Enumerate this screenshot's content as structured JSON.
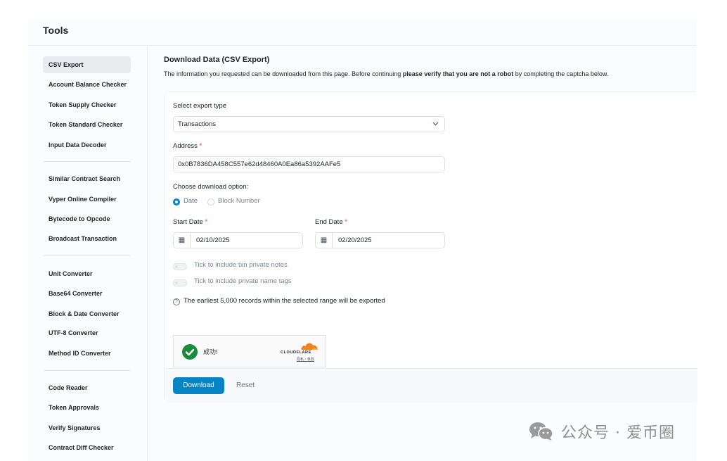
{
  "page": {
    "title": "Tools"
  },
  "sidebar": {
    "groups": [
      {
        "items": [
          {
            "label": "CSV Export",
            "active": true
          },
          {
            "label": "Account Balance Checker"
          },
          {
            "label": "Token Supply Checker"
          },
          {
            "label": "Token Standard Checker"
          },
          {
            "label": "Input Data Decoder"
          }
        ]
      },
      {
        "items": [
          {
            "label": "Similar Contract Search"
          },
          {
            "label": "Vyper Online Compiler"
          },
          {
            "label": "Bytecode to Opcode"
          },
          {
            "label": "Broadcast Transaction"
          }
        ]
      },
      {
        "items": [
          {
            "label": "Unit Converter"
          },
          {
            "label": "Base64 Converter"
          },
          {
            "label": "Block & Date Converter"
          },
          {
            "label": "UTF-8 Converter"
          },
          {
            "label": "Method ID Converter"
          }
        ]
      },
      {
        "items": [
          {
            "label": "Code Reader"
          },
          {
            "label": "Token Approvals"
          },
          {
            "label": "Verify Signatures"
          },
          {
            "label": "Contract Diff Checker"
          }
        ]
      }
    ]
  },
  "main": {
    "title": "Download Data (CSV Export)",
    "subtitle_before": "The information you requested can be downloaded from this page. Before continuing ",
    "subtitle_bold": "please verify that you are not a robot",
    "subtitle_after": " by completing the captcha below.",
    "export_type": {
      "label": "Select export type",
      "value": "Transactions"
    },
    "address": {
      "label": "Address",
      "required_mark": "*",
      "value": "0x0B7836DA458C557e62d48460A0Ea86a5392AAFe5"
    },
    "download_option": {
      "label": "Choose download option:",
      "options": [
        {
          "label": "Date",
          "selected": true
        },
        {
          "label": "Block Number",
          "selected": false
        }
      ]
    },
    "start_date": {
      "label": "Start Date",
      "required_mark": "*",
      "value": "02/10/2025"
    },
    "end_date": {
      "label": "End Date",
      "required_mark": "*",
      "value": "02/20/2025"
    },
    "toggles": [
      {
        "label": "Tick to include txn private notes",
        "checked": false
      },
      {
        "label": "Tick to include private name tags",
        "checked": false
      }
    ],
    "info_text": "The earliest 5,000 records within the selected range will be exported",
    "captcha": {
      "status_text": "成功!",
      "brand": "CLOUDFLARE",
      "links": "隐私・条款"
    },
    "buttons": {
      "download": "Download",
      "reset": "Reset"
    }
  },
  "watermark": {
    "text": "公众号 · 爱币圈"
  },
  "colors": {
    "primary": "#0784c3",
    "success": "#1c8a3d",
    "cloudflare": "#f48120",
    "required": "#dc3545"
  }
}
